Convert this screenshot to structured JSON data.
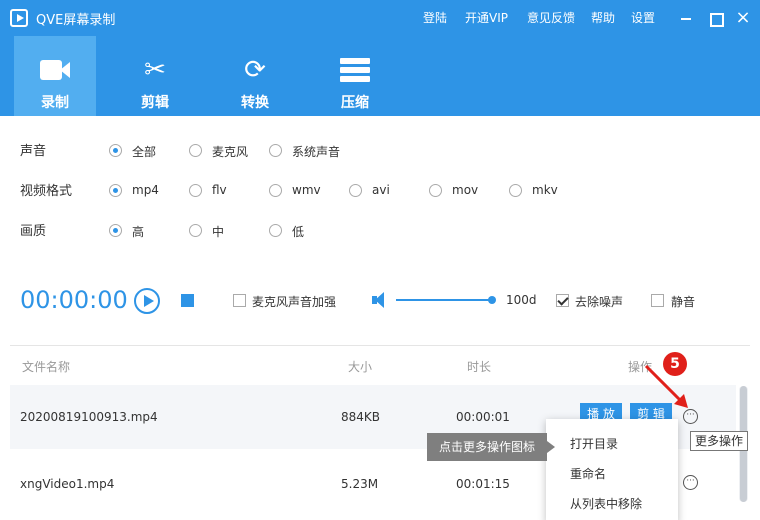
{
  "titlebar": {
    "title": "QVE屏幕录制",
    "menu": [
      "登陆",
      "开通VIP",
      "意见反馈",
      "帮助",
      "设置"
    ],
    "close": "×"
  },
  "toolbar": {
    "tabs": [
      {
        "label": "录制",
        "icon": "camera-icon"
      },
      {
        "label": "剪辑",
        "icon": "scissors-icon"
      },
      {
        "label": "转换",
        "icon": "refresh-icon"
      },
      {
        "label": "压缩",
        "icon": "compress-icon"
      }
    ],
    "active": "录制",
    "scissors_glyph": "✂",
    "refresh_glyph": "⟳"
  },
  "settings": {
    "sound": {
      "label": "声音",
      "options": [
        "全部",
        "麦克风",
        "系统声音"
      ],
      "selected": "全部"
    },
    "format": {
      "label": "视频格式",
      "options": [
        "mp4",
        "flv",
        "wmv",
        "avi",
        "mov",
        "mkv"
      ],
      "selected": "mp4"
    },
    "quality": {
      "label": "画质",
      "options": [
        "高",
        "中",
        "低"
      ],
      "selected": "高"
    }
  },
  "recorder": {
    "timer": "00:00:00",
    "mic_boost": {
      "label": "麦克风声音加强",
      "checked": false
    },
    "volume_value": "100d",
    "volume_level": 1.0,
    "denoise": {
      "label": "去除噪声",
      "checked": true
    },
    "mute": {
      "label": "静音",
      "checked": false
    }
  },
  "table": {
    "headers": {
      "name": "文件名称",
      "size": "大小",
      "duration": "时长",
      "actions": "操作"
    },
    "rows": [
      {
        "name": "20200819100913.mp4",
        "size": "884KB",
        "duration": "00:00:01",
        "play": "播 放",
        "edit": "剪 辑",
        "more": "···"
      },
      {
        "name": "xngVideo1.mp4",
        "size": "5.23M",
        "duration": "00:01:15",
        "more": "···"
      }
    ]
  },
  "context_menu": {
    "items": [
      "打开目录",
      "重命名",
      "从列表中移除"
    ]
  },
  "annotations": {
    "callout": "点击更多操作图标",
    "tooltip": "更多操作",
    "step": "5",
    "step_color": "#e0201a"
  },
  "colors": {
    "accent": "#2e94e6",
    "active_tab": "#52aef0"
  }
}
